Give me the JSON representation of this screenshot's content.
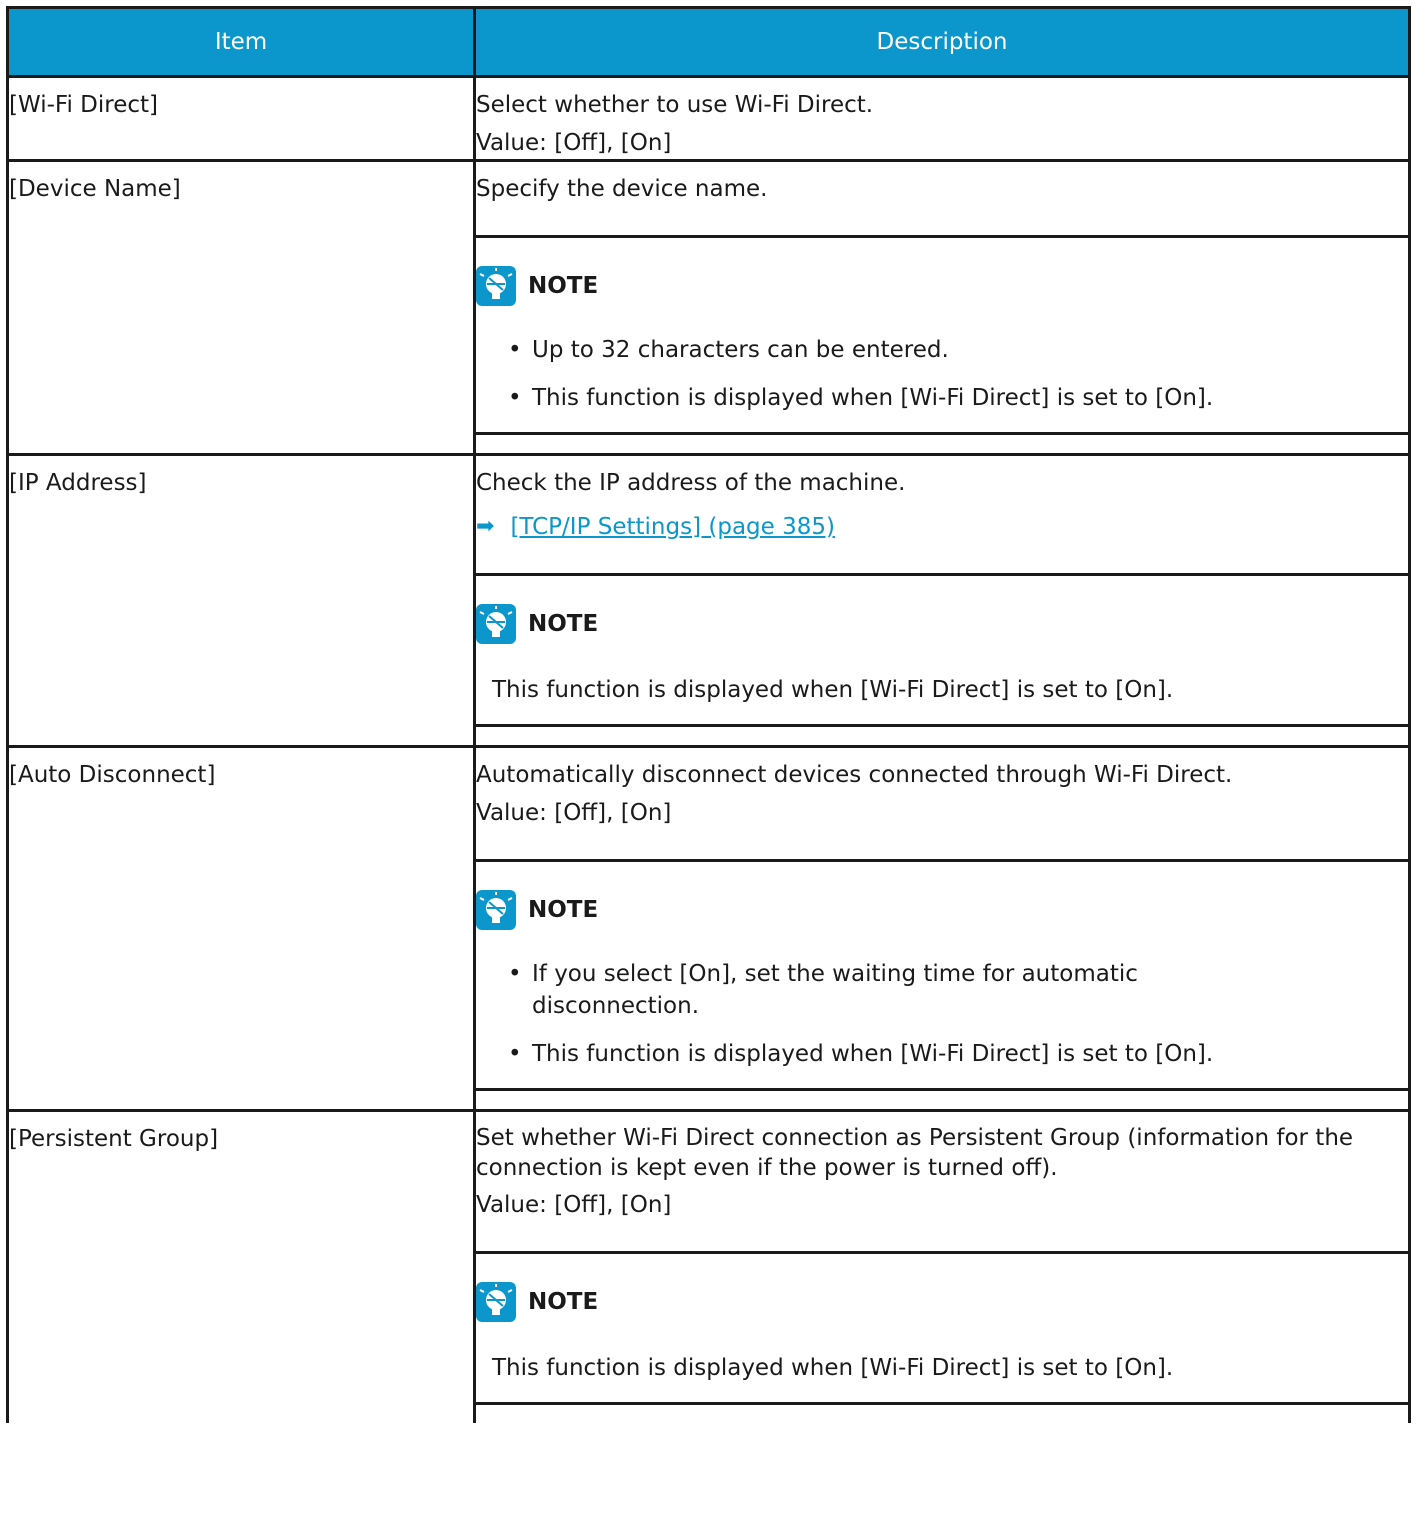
{
  "table": {
    "headers": {
      "item": "Item",
      "description": "Description"
    },
    "note_label": "NOTE",
    "rows": [
      {
        "item": "[Wi-Fi Direct]",
        "lines": [
          "Select whether to use Wi-Fi Direct.",
          "Value: [Off], [On]"
        ]
      },
      {
        "item": "[Device Name]",
        "lines": [
          "Specify the device name."
        ],
        "note_bullets": [
          "Up to 32 characters can be entered.",
          "This function is displayed when [Wi-Fi Direct] is set to [On]."
        ]
      },
      {
        "item": "[IP Address]",
        "lines": [
          "Check the IP address of the machine."
        ],
        "link": "[TCP/IP Settings] (page 385)",
        "note_text": "This function is displayed when [Wi-Fi Direct] is set to [On]."
      },
      {
        "item": "[Auto Disconnect]",
        "lines": [
          "Automatically disconnect devices connected through Wi-Fi Direct.",
          "Value: [Off], [On]"
        ],
        "note_bullets": [
          "If you select [On], set the waiting time for automatic disconnection.",
          "This function is displayed when [Wi-Fi Direct] is set to [On]."
        ]
      },
      {
        "item": "[Persistent Group]",
        "lines": [
          "Set whether Wi-Fi Direct connection as Persistent Group (information for the connection is kept even if the power is turned off).",
          "Value: [Off], [On]"
        ],
        "note_text": "This function is displayed when [Wi-Fi Direct] is set to [On]."
      }
    ]
  },
  "icons": {
    "note": "lightbulb-note-icon",
    "link_arrow": "arrow-right-icon"
  },
  "colors": {
    "header_bg": "#0b97cc",
    "link": "#0b97cc",
    "border": "#1a1a1a"
  }
}
